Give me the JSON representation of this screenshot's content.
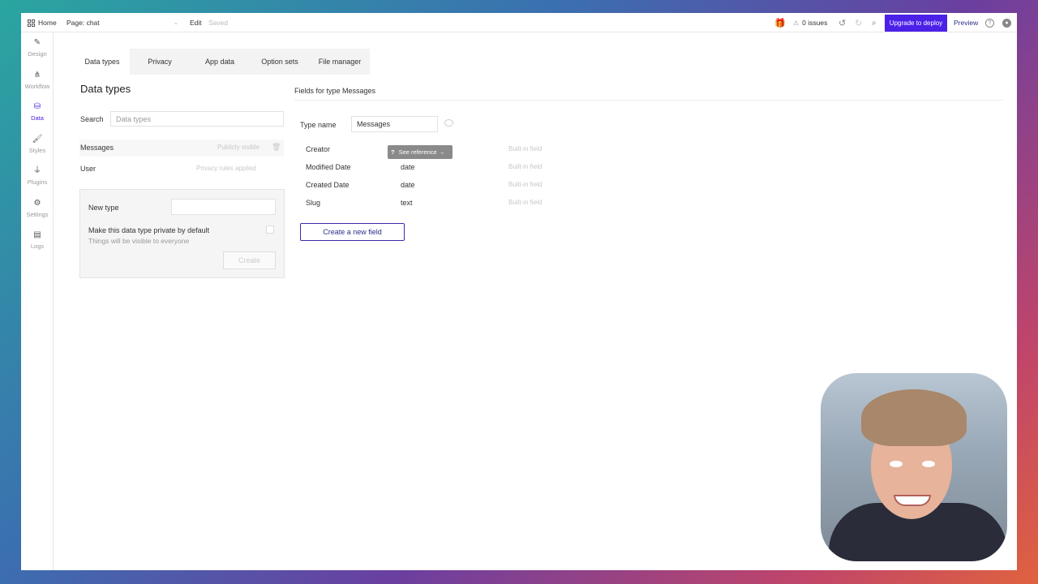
{
  "topbar": {
    "home_label": "Home",
    "page_label": "Page: chat",
    "edit_label": "Edit",
    "saved_label": "Saved",
    "issues_label": "0 issues",
    "upgrade_label": "Upgrade to deploy",
    "preview_label": "Preview"
  },
  "sidebar": {
    "items": [
      {
        "label": "Design",
        "icon": "design-icon"
      },
      {
        "label": "Workflow",
        "icon": "workflow-icon"
      },
      {
        "label": "Data",
        "icon": "database-icon"
      },
      {
        "label": "Styles",
        "icon": "brush-icon"
      },
      {
        "label": "Plugins",
        "icon": "plug-icon"
      },
      {
        "label": "Settings",
        "icon": "gear-icon"
      },
      {
        "label": "Logs",
        "icon": "document-icon"
      }
    ]
  },
  "tabs": [
    "Data types",
    "Privacy",
    "App data",
    "Option sets",
    "File manager"
  ],
  "data_types": {
    "title": "Data types",
    "search_label": "Search",
    "search_placeholder": "Data types",
    "items": [
      {
        "name": "Messages",
        "status": "Publicly visible"
      },
      {
        "name": "User",
        "status": "Privacy rules applied"
      }
    ],
    "new_type_label": "New type",
    "private_label": "Make this data type private by default",
    "private_sub": "Things will be visible to everyone",
    "create_label": "Create"
  },
  "fields": {
    "heading": "Fields for type Messages",
    "type_name_label": "Type name",
    "type_name_value": "Messages",
    "reference_label": "See reference →",
    "rows": [
      {
        "name": "Creator",
        "type": "",
        "note": "Built-in field"
      },
      {
        "name": "Modified Date",
        "type": "date",
        "note": "Built-in field"
      },
      {
        "name": "Created Date",
        "type": "date",
        "note": "Built-in field"
      },
      {
        "name": "Slug",
        "type": "text",
        "note": "Built-in field"
      }
    ],
    "create_field_label": "Create a new field"
  },
  "colors": {
    "accent": "#4b21e8",
    "button_border": "#3a2aa8"
  }
}
